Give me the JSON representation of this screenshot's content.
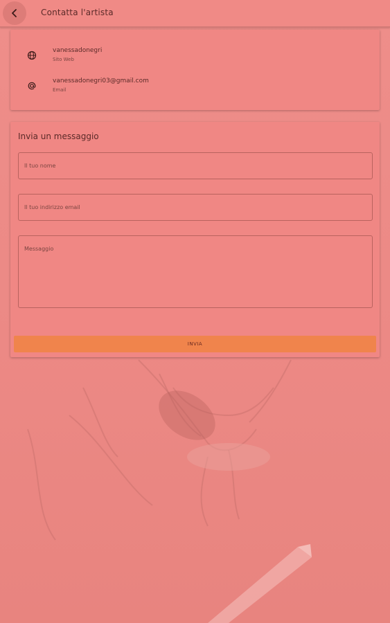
{
  "appbar": {
    "title": "Contatta l'artista"
  },
  "contact": [
    {
      "icon": "globe-icon",
      "primary": "vanessadonegri",
      "secondary": "Sito Web"
    },
    {
      "icon": "at-icon",
      "primary": "vanessadonegri03@gmail.com",
      "secondary": "Email"
    }
  ],
  "form": {
    "title": "Invia un messaggio",
    "name_placeholder": "Il tuo nome",
    "email_placeholder": "Il tuo indirizzo email",
    "message_placeholder": "Messaggio",
    "send_label": "INVIA"
  },
  "colors": {
    "overlay": "#ef8f8b",
    "accent": "#f0844c"
  }
}
